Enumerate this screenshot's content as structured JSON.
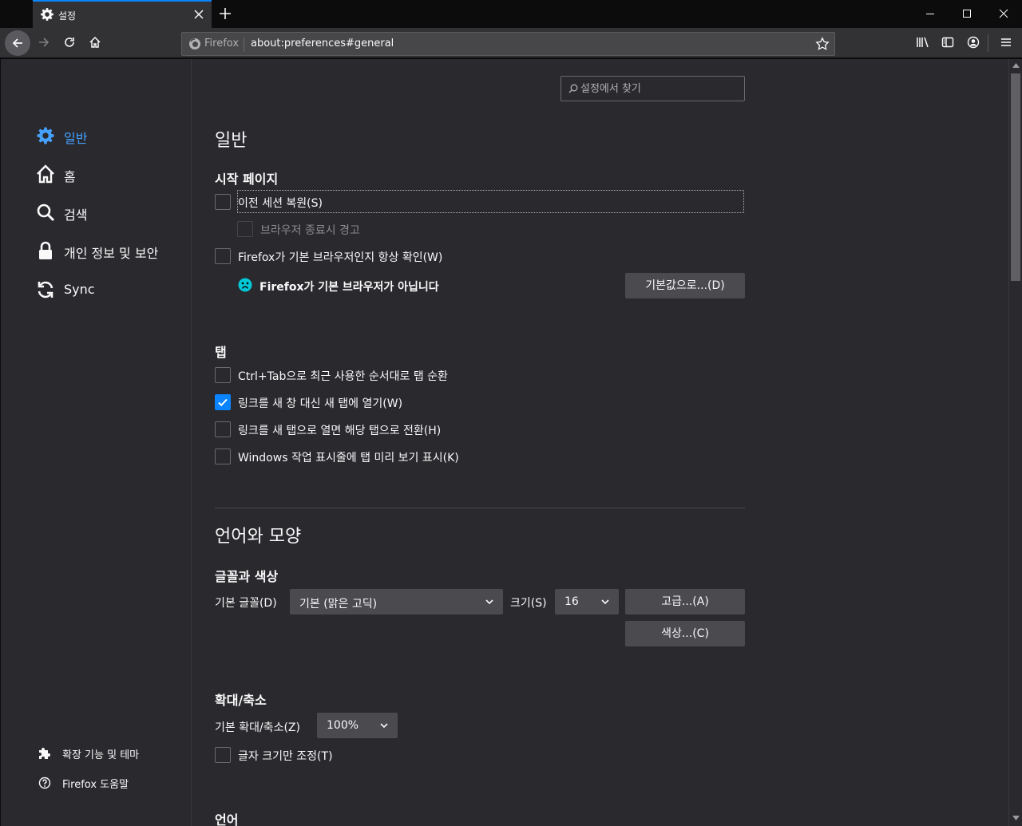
{
  "tab": {
    "title": "설정"
  },
  "urlbar": {
    "identity": "Firefox",
    "url": "about:preferences#general"
  },
  "sidebar": {
    "categories": [
      {
        "label": "일반",
        "icon": "gear-icon",
        "selected": true
      },
      {
        "label": "홈",
        "icon": "home-icon"
      },
      {
        "label": "검색",
        "icon": "search-icon"
      },
      {
        "label": "개인 정보 및 보안",
        "icon": "lock-icon"
      },
      {
        "label": "Sync",
        "icon": "sync-icon"
      }
    ],
    "footer": [
      {
        "label": "확장 기능 및 테마",
        "icon": "puzzle-icon"
      },
      {
        "label": "Firefox 도움말",
        "icon": "help-icon"
      }
    ]
  },
  "search": {
    "placeholder": "설정에서 찾기"
  },
  "general": {
    "heading": "일반",
    "startup": {
      "heading": "시작 페이지",
      "restore_session": {
        "label": "이전 세션 복원(S)",
        "checked": false
      },
      "warn_on_quit": {
        "label": "브라우저 종료시 경고",
        "checked": false,
        "disabled": true
      },
      "check_default": {
        "label": "Firefox가 기본 브라우저인지 항상 확인(W)",
        "checked": false
      },
      "not_default_text": "Firefox가 기본 브라우저가 아닙니다",
      "set_default_button": "기본값으로...(D)"
    },
    "tabs": {
      "heading": "탭",
      "options": [
        {
          "label": "Ctrl+Tab으로 최근 사용한 순서대로 탭 순환",
          "checked": false
        },
        {
          "label": "링크를 새 창 대신 새 탭에 열기(W)",
          "checked": true
        },
        {
          "label": "링크를 새 탭으로 열면 해당 탭으로 전환(H)",
          "checked": false
        },
        {
          "label": "Windows 작업 표시줄에 탭 미리 보기 표시(K)",
          "checked": false
        }
      ]
    }
  },
  "language_appearance": {
    "heading": "언어와 모양",
    "fonts_colors": {
      "heading": "글꼴과 색상",
      "default_font_label": "기본 글꼴(D)",
      "default_font_value": "기본 (맑은 고딕)",
      "size_label": "크기(S)",
      "size_value": "16",
      "advanced_button": "고급...(A)",
      "colors_button": "색상...(C)"
    },
    "zoom": {
      "heading": "확대/축소",
      "default_zoom_label": "기본 확대/축소(Z)",
      "default_zoom_value": "100%",
      "text_only": {
        "label": "글자 크기만 조정(T)",
        "checked": false
      }
    },
    "language": {
      "heading": "언어"
    }
  },
  "colors": {
    "accent": "#0a84ff",
    "selected_text": "#45a1ff",
    "background": "#2a2a2e",
    "toolbar": "#323234"
  }
}
